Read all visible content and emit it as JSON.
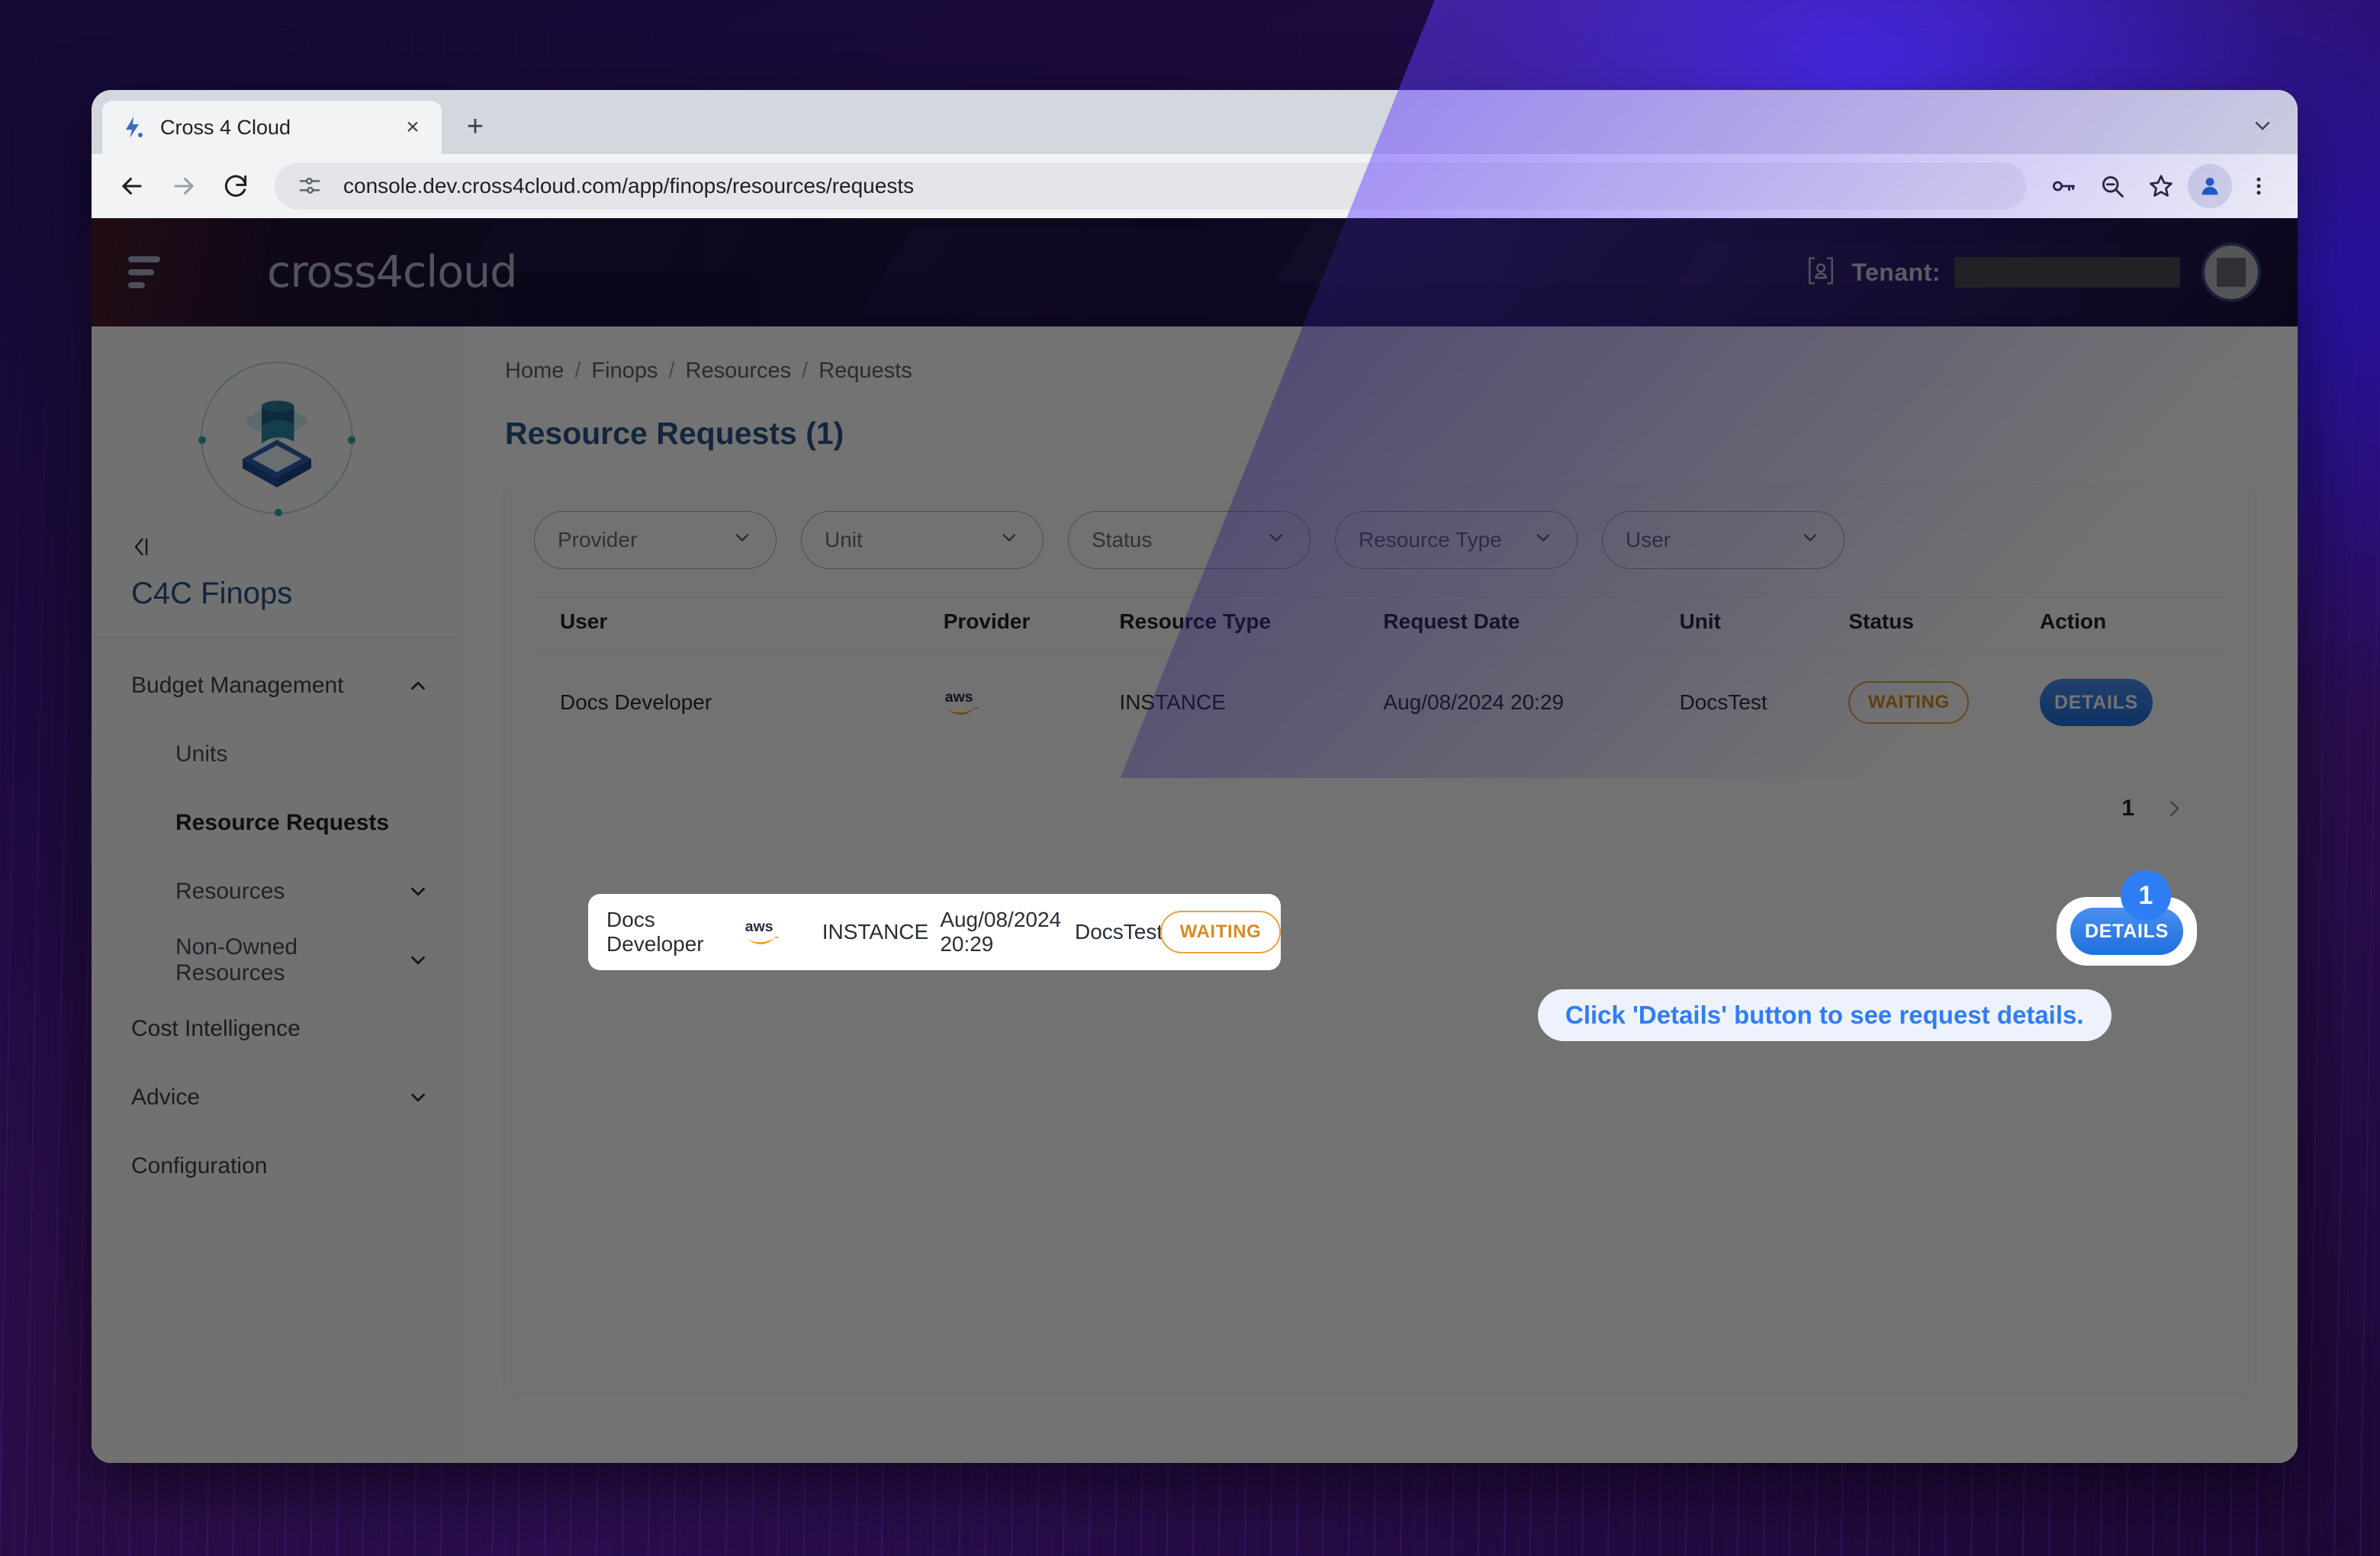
{
  "browser": {
    "tab": {
      "title": "Cross 4 Cloud",
      "favicon": "cross4cloud-logo-icon",
      "close": "×"
    },
    "new_tab": "+",
    "nav": {
      "back": "back-icon",
      "forward": "forward-icon",
      "reload": "reload-icon"
    },
    "omnibox": {
      "url": "console.dev.cross4cloud.com/app/finops/resources/requests",
      "site_icon": "site-settings-icon"
    },
    "toolbar_icons": [
      "password-key-icon",
      "zoom-out-icon",
      "bookmark-star-icon",
      "profile-avatar-icon",
      "browser-menu-icon"
    ]
  },
  "appbar": {
    "menu": "hamburger-icon",
    "brand": "cross4cloud",
    "tenant_label": "Tenant:",
    "tenant_value": "",
    "avatar": "user-avatar"
  },
  "sidebar": {
    "app_title": "C4C Finops",
    "collapse": "collapse-sidebar-icon",
    "items": [
      {
        "label": "Budget Management",
        "level": 0,
        "chevron": "up",
        "active": false
      },
      {
        "label": "Units",
        "level": 1,
        "chevron": "",
        "active": false
      },
      {
        "label": "Resource Requests",
        "level": 1,
        "chevron": "",
        "active": true
      },
      {
        "label": "Resources",
        "level": 1,
        "chevron": "down",
        "active": false
      },
      {
        "label": "Non-Owned Resources",
        "level": 1,
        "chevron": "down",
        "active": false
      },
      {
        "label": "Cost Intelligence",
        "level": 0,
        "chevron": "",
        "active": false
      },
      {
        "label": "Advice",
        "level": 0,
        "chevron": "down",
        "active": false
      },
      {
        "label": "Configuration",
        "level": 0,
        "chevron": "",
        "active": false
      }
    ]
  },
  "main": {
    "breadcrumb": [
      "Home",
      "Finops",
      "Resources",
      "Requests"
    ],
    "breadcrumb_separator": "/",
    "page_title": "Resource Requests (1)",
    "filters": [
      {
        "label": "Provider"
      },
      {
        "label": "Unit"
      },
      {
        "label": "Status"
      },
      {
        "label": "Resource Type"
      },
      {
        "label": "User"
      }
    ],
    "table": {
      "columns": [
        "User",
        "Provider",
        "Resource Type",
        "Request Date",
        "Unit",
        "Status",
        "Action"
      ],
      "rows": [
        {
          "user": "Docs Developer",
          "provider": "aws",
          "resource_type": "INSTANCE",
          "request_date": "Aug/08/2024 20:29",
          "unit": "DocsTest",
          "status": "WAITING",
          "action": "DETAILS"
        }
      ]
    },
    "pagination": {
      "current": "1",
      "next": "next-page-icon"
    }
  },
  "overlay": {
    "step_number": "1",
    "tooltip_text": "Click 'Details' button to see request details."
  },
  "colors": {
    "accent_blue": "#2f7df4",
    "title_blue": "#2b5486",
    "status_orange": "#d78b1f",
    "appbar_navy": "#1a1140",
    "aws_orange": "#ef9d2a"
  }
}
